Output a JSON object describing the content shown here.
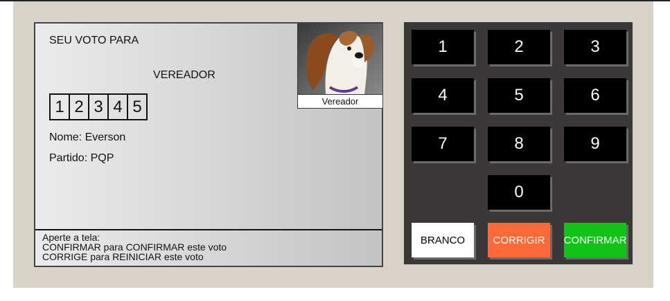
{
  "screen": {
    "heading": "SEU VOTO PARA",
    "office": "VEREADOR",
    "digits": [
      "1",
      "2",
      "3",
      "4",
      "5"
    ],
    "candidate_name": "Nome: Everson",
    "candidate_party": "Partido: PQP",
    "photo_caption": "Vereador",
    "instructions": {
      "line1": "Aperte a tela:",
      "line2": "CONFIRMAR para CONFIRMAR este voto",
      "line3": "CORRIGE para REINICIAR este voto"
    }
  },
  "keypad": {
    "keys": [
      "1",
      "2",
      "3",
      "4",
      "5",
      "6",
      "7",
      "8",
      "9",
      "0"
    ],
    "branco": "BRANCO",
    "corrigir": "CORRIGIR",
    "confirmar": "CONFIRMAR",
    "colors": {
      "branco_bg": "#ffffff",
      "corrigir_bg": "#fc6a3a",
      "confirmar_bg": "#11c317"
    }
  }
}
